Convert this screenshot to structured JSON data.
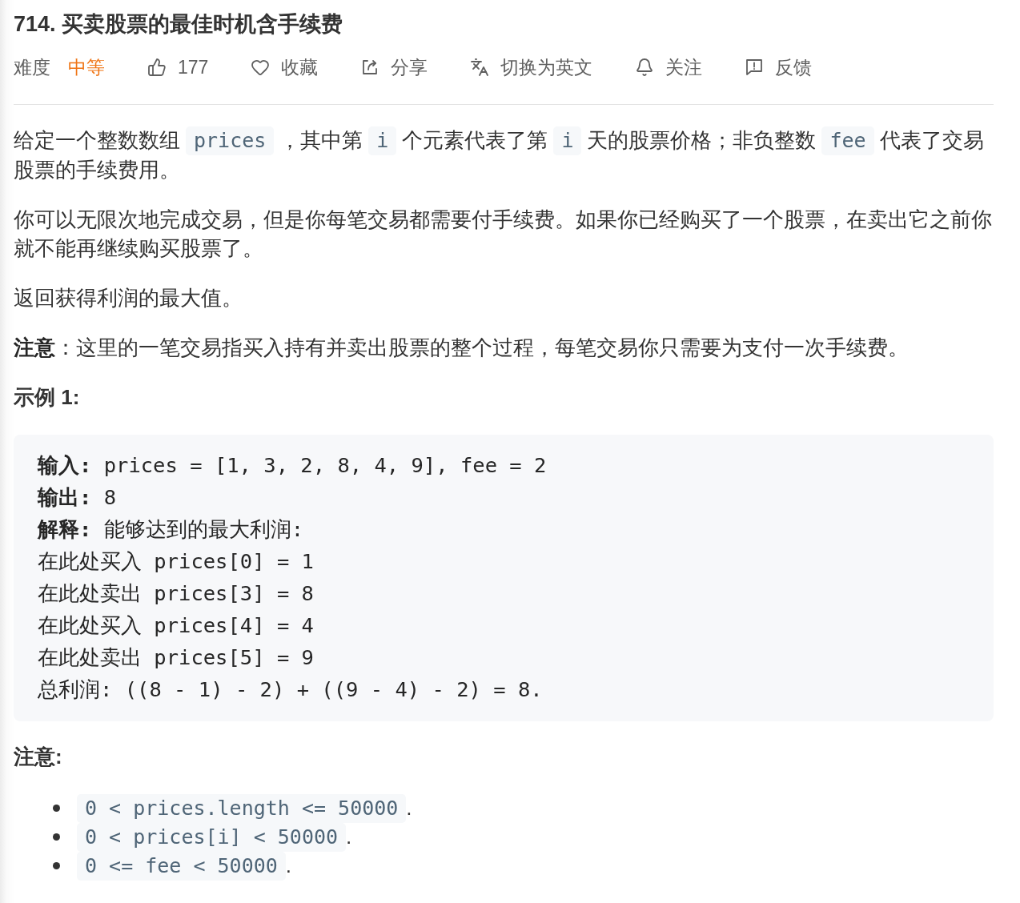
{
  "title": "714. 买卖股票的最佳时机含手续费",
  "difficulty": {
    "label": "难度",
    "value": "中等",
    "kind": "medium"
  },
  "actions": [
    {
      "kind": "like",
      "label": "177"
    },
    {
      "kind": "favorite",
      "label": "收藏"
    },
    {
      "kind": "share",
      "label": "分享"
    },
    {
      "kind": "translate",
      "label": "切换为英文"
    },
    {
      "kind": "follow",
      "label": "关注"
    },
    {
      "kind": "feedback",
      "label": "反馈"
    }
  ],
  "description": [
    {
      "parts": [
        {
          "kind": "text",
          "text": "给定一个整数数组"
        },
        {
          "kind": "code",
          "text": "prices"
        },
        {
          "kind": "text",
          "text": "，其中第"
        },
        {
          "kind": "code",
          "text": "i"
        },
        {
          "kind": "text",
          "text": "个元素代表了第"
        },
        {
          "kind": "code",
          "text": "i"
        },
        {
          "kind": "text",
          "text": "天的股票价格；非负整数"
        },
        {
          "kind": "code",
          "text": "fee"
        },
        {
          "kind": "text",
          "text": "代表了交易股票的手续费用。"
        }
      ]
    },
    {
      "parts": [
        {
          "kind": "text",
          "text": "你可以无限次地完成交易，但是你每笔交易都需要付手续费。如果你已经购买了一个股票，在卖出它之前你就不能再继续购买股票了。"
        }
      ]
    },
    {
      "parts": [
        {
          "kind": "text",
          "text": "返回获得利润的最大值。"
        }
      ]
    },
    {
      "parts": [
        {
          "kind": "text",
          "text": "**注意**：这里的一笔交易指买入持有并卖出股票的整个过程，每笔交易你只需要为支付一次手续费。"
        }
      ]
    }
  ],
  "example": {
    "heading": "示例 1:",
    "lines": [
      "**输入:** prices = [1, 3, 2, 8, 4, 9], fee = 2",
      "**输出:** 8",
      "**解释:** 能够达到的最大利润:",
      "在此处买入 prices[0] = 1",
      "在此处卖出 prices[3] = 8",
      "在此处买入 prices[4] = 4",
      "在此处卖出 prices[5] = 9",
      "总利润: ((8 - 1) - 2) + ((9 - 4) - 2) = 8."
    ]
  },
  "notes": {
    "heading": "注意:",
    "items": [
      {
        "parts": [
          {
            "kind": "code",
            "text": "0 < prices.length <= 50000"
          },
          {
            "kind": "text",
            "text": "."
          }
        ]
      },
      {
        "parts": [
          {
            "kind": "code",
            "text": "0 < prices[i] < 50000"
          },
          {
            "kind": "text",
            "text": "."
          }
        ]
      },
      {
        "parts": [
          {
            "kind": "code",
            "text": "0 <= fee < 50000"
          },
          {
            "kind": "text",
            "text": "."
          }
        ]
      }
    ]
  }
}
